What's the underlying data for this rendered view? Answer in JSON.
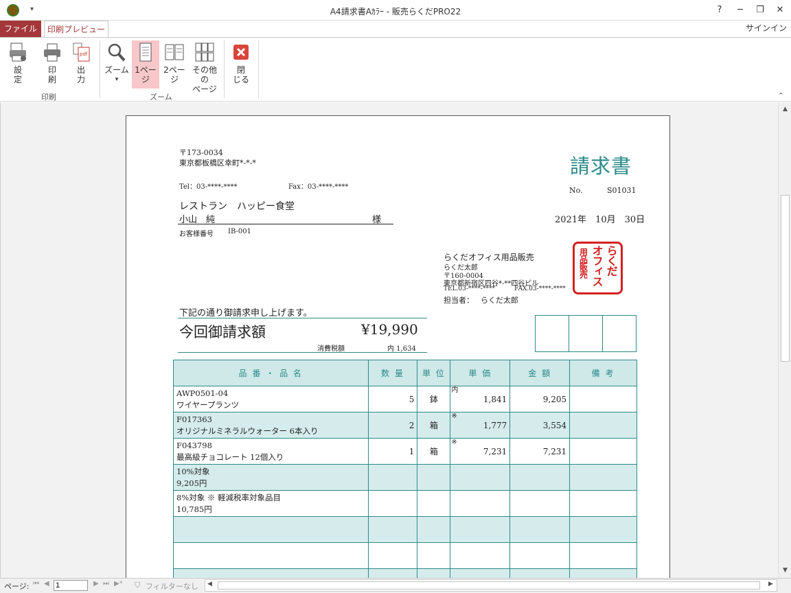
{
  "window": {
    "title": "A4請求書Aｶﾗｰ - 販売らくだPRO22",
    "help": "?",
    "minimize": "─",
    "restore": "❐",
    "close": "✕",
    "qat": "▾"
  },
  "tabs": {
    "file": "ファイル",
    "print_preview": "印刷プレビュー",
    "signin": "サインイン"
  },
  "ribbon": {
    "settings": "設\n定",
    "print": "印\n刷",
    "output": "出\n力",
    "zoom": "ズーム",
    "one_page": "1ペー\nジ",
    "two_page": "2ペー\nジ",
    "other_pages": "その他の\nページ",
    "close": "閉\nじる",
    "group_print": "印刷",
    "group_zoom": "ズーム",
    "dropdown_mark": "▾",
    "collapse": "⌃"
  },
  "invoice": {
    "sender_zip": "〒173-0034",
    "sender_address": "東京都板橋区幸町*-*-*",
    "sender_tel": "Tel：03-****-****",
    "sender_fax": "Fax：03-****-****",
    "title": "請求書",
    "no_label": "No.",
    "no_value": "S01031",
    "customer_name": "レストラン　ハッピー食堂",
    "customer_person": "小山　純",
    "honorific": "様",
    "customer_no_label": "お客様番号",
    "customer_no": "IB-001",
    "date": "2021年　10月　30日",
    "issuer_company": "らくだオフィス用品販売",
    "issuer_person": "らくだ太郎",
    "issuer_zip": "〒160-0004",
    "issuer_address": "東京都新宿区四谷*-**四谷ビル",
    "issuer_tel": "TEL.03-****-****",
    "issuer_fax": "FAX.03-****-****",
    "tantou_label": "担当者：",
    "tantou": "らくだ太郎",
    "stamp_col1": "らくだ",
    "stamp_col2": "オフィス",
    "stamp_col3": "用品販売",
    "greeting": "下記の通り御請求申し上げます。",
    "amount_label": "今回御請求額",
    "amount": "¥19,990",
    "tax_label": "消費税額",
    "tax_value": "内 1,634",
    "headers": [
      "品 番 ・ 品 名",
      "数 量",
      "単 位",
      "単 価",
      "金 額",
      "備 考"
    ],
    "items": [
      {
        "code": "AWP0501-04",
        "name": "ワイヤープランツ",
        "qty": "5",
        "unit": "鉢",
        "mark": "内",
        "price": "1,841",
        "amount": "9,205",
        "note": ""
      },
      {
        "code": "F017363",
        "name": "オリジナルミネラルウォーター 6本入り",
        "qty": "2",
        "unit": "箱",
        "mark": "※",
        "price": "1,777",
        "amount": "3,554",
        "note": ""
      },
      {
        "code": "F043798",
        "name": "最高級チョコレート 12個入り",
        "qty": "1",
        "unit": "箱",
        "mark": "※",
        "price": "7,231",
        "amount": "7,231",
        "note": ""
      }
    ],
    "summary_10_label": "10%対象",
    "summary_10_value": "9,205円",
    "summary_8_label": "8%対象 ※ 軽減税率対象品目",
    "summary_8_value": "10,785円"
  },
  "status": {
    "page_label": "ページ:",
    "page_value": "1",
    "filter": "フィルターなし"
  }
}
